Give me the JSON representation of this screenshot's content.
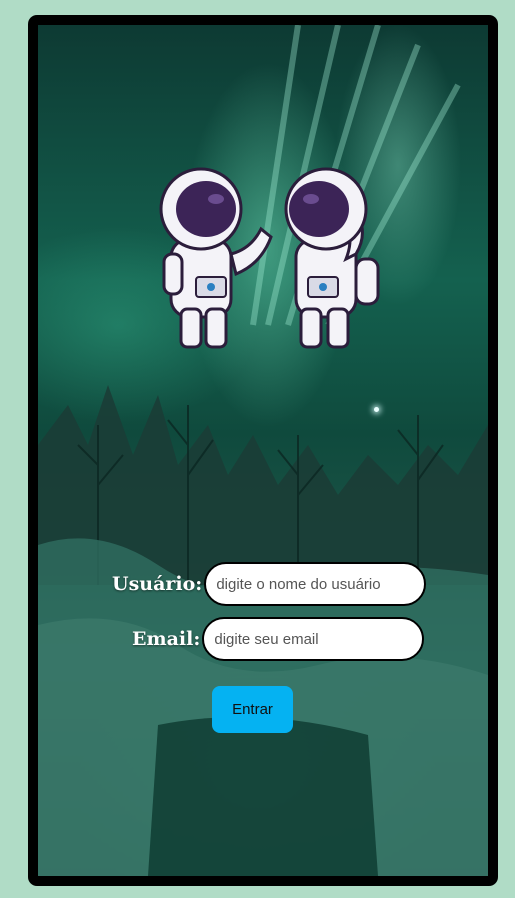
{
  "background": {
    "page_color": "#b0dcc6",
    "frame_color": "#000000",
    "scene": "aurora-winter-forest"
  },
  "hero": {
    "image": "two-astronauts-illustration"
  },
  "form": {
    "username": {
      "label": "Usuário:",
      "placeholder": "digite o nome do usuário",
      "value": ""
    },
    "email": {
      "label": "Email:",
      "placeholder": "digite seu email",
      "value": ""
    },
    "submit_label": "Entrar",
    "accent_color": "#05b2f2"
  }
}
